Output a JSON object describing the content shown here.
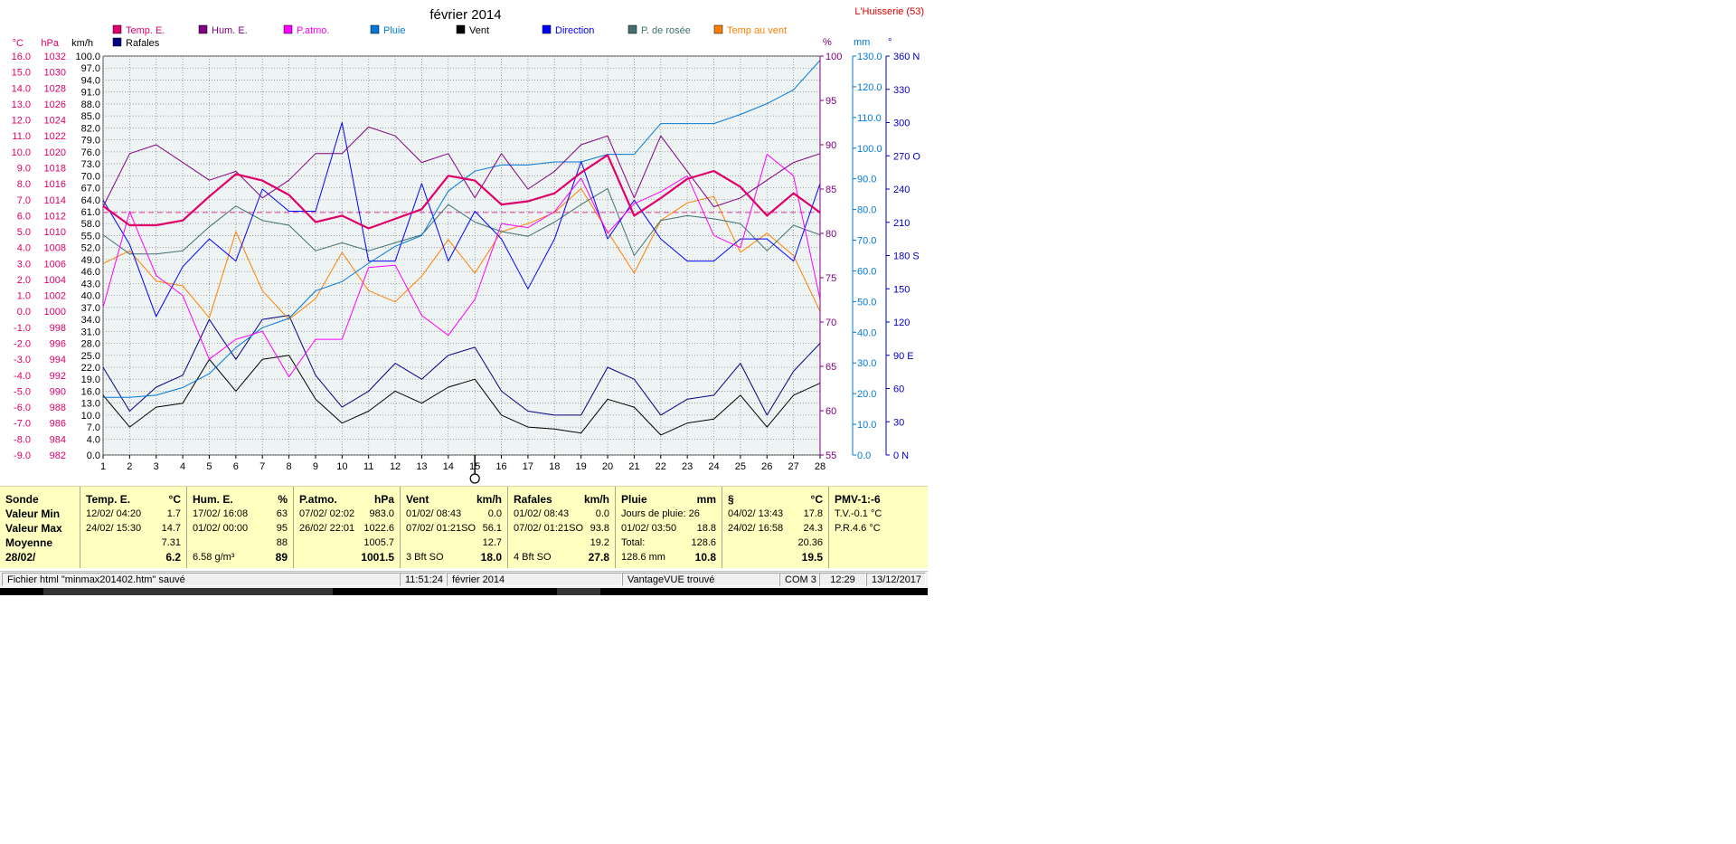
{
  "chart_data": {
    "type": "line",
    "title": "février 2014",
    "location": "L'Huisserie (53)",
    "x": [
      1,
      2,
      3,
      4,
      5,
      6,
      7,
      8,
      9,
      10,
      11,
      12,
      13,
      14,
      15,
      16,
      17,
      18,
      19,
      20,
      21,
      22,
      23,
      24,
      25,
      26,
      27,
      28
    ],
    "xlim": [
      1,
      28
    ],
    "left_axes": [
      {
        "label": "°C",
        "color": "#e0006a",
        "min": -9,
        "max": 16,
        "ticks": [
          "16.0",
          "15.0",
          "14.0",
          "13.0",
          "12.0",
          "11.0",
          "10.0",
          "9.0",
          "8.0",
          "7.0",
          "6.0",
          "5.0",
          "4.0",
          "3.0",
          "2.0",
          "1.0",
          "0.0",
          "-1.0",
          "-2.0",
          "-3.0",
          "-4.0",
          "-5.0",
          "-6.0",
          "-7.0",
          "-8.0",
          "-9.0"
        ]
      },
      {
        "label": "hPa",
        "color": "#e0006a",
        "min": 982,
        "max": 1032,
        "ticks": [
          "1032",
          "1030",
          "1028",
          "1026",
          "1024",
          "1022",
          "1020",
          "1018",
          "1016",
          "1014",
          "1012",
          "1010",
          "1008",
          "1006",
          "1004",
          "1002",
          "1000",
          "998",
          "996",
          "994",
          "992",
          "990",
          "988",
          "986",
          "984",
          "982"
        ]
      },
      {
        "label": "km/h",
        "color": "#000000",
        "min": 0,
        "max": 100,
        "ticks": [
          "100.0",
          "97.0",
          "94.0",
          "91.0",
          "88.0",
          "85.0",
          "82.0",
          "79.0",
          "76.0",
          "73.0",
          "70.0",
          "67.0",
          "64.0",
          "61.0",
          "58.0",
          "55.0",
          "52.0",
          "49.0",
          "46.0",
          "43.0",
          "40.0",
          "37.0",
          "34.0",
          "31.0",
          "28.0",
          "25.0",
          "22.0",
          "19.0",
          "16.0",
          "13.0",
          "10.0",
          "7.0",
          "4.0",
          "0.0"
        ]
      }
    ],
    "right_axes": [
      {
        "label": "%",
        "color": "#800080",
        "min": 55,
        "max": 100,
        "ticks": [
          "100",
          "95",
          "90",
          "85",
          "80",
          "75",
          "70",
          "65",
          "60",
          "55"
        ]
      },
      {
        "label": "mm",
        "color": "#0078d7",
        "min": 0,
        "max": 130,
        "ticks": [
          "130.0",
          "120.0",
          "110.0",
          "100.0",
          "90.0",
          "80.0",
          "70.0",
          "60.0",
          "50.0",
          "40.0",
          "30.0",
          "20.0",
          "10.0",
          "0.0"
        ]
      },
      {
        "label": "°",
        "color": "#0000c0",
        "min": 0,
        "max": 360,
        "ticks": [
          "360 N",
          "330",
          "300",
          "270 O",
          "240",
          "210",
          "180 S",
          "150",
          "120",
          "90 E",
          "60",
          "30",
          "0 N"
        ]
      }
    ],
    "grid": true,
    "legend_position": "top",
    "reference_line": {
      "axis": "°C",
      "value": 6.2,
      "color": "#e040a0",
      "style": "dashed"
    },
    "cursor_day": 15,
    "series": [
      {
        "name": "Temp. E.",
        "color": "#e0006a",
        "axis": "°C",
        "width": 2.2,
        "values": [
          6.6,
          5.4,
          5.4,
          5.7,
          7.2,
          8.6,
          8.2,
          7.3,
          5.6,
          6.0,
          5.2,
          5.8,
          6.4,
          8.5,
          8.2,
          6.7,
          6.9,
          7.4,
          8.7,
          9.8,
          6.0,
          7.1,
          8.3,
          8.8,
          7.8,
          6.0,
          7.4,
          6.2
        ]
      },
      {
        "name": "Hum. E.",
        "color": "#800080",
        "axis": "%",
        "width": 1,
        "values": [
          83,
          89,
          90,
          88,
          86,
          87,
          84,
          86,
          89,
          89,
          92,
          91,
          88,
          89,
          84,
          89,
          85,
          87,
          90,
          91,
          84,
          91,
          87,
          83,
          84,
          86,
          88,
          89
        ]
      },
      {
        "name": "P.atmo.",
        "color": "#ff00ff",
        "axis": "hPa",
        "width": 1,
        "values": [
          1000.5,
          1012.5,
          1004.5,
          1002.0,
          994.0,
          996.5,
          997.5,
          991.8,
          996.5,
          996.5,
          1005.5,
          1005.8,
          999.5,
          997.0,
          1001.5,
          1011.0,
          1010.5,
          1012.5,
          1016.7,
          1009.8,
          1013.5,
          1015.0,
          1017.0,
          1009.5,
          1008.0,
          1019.7,
          1017.0,
          1001.5
        ]
      },
      {
        "name": "Pluie",
        "color": "#0078d7",
        "axis": "mm",
        "width": 1,
        "values": [
          18.8,
          18.8,
          19.5,
          22.0,
          26.5,
          35.0,
          41.5,
          44.5,
          53.5,
          56.5,
          62.5,
          68.0,
          71.5,
          86.0,
          92.5,
          94.5,
          94.5,
          95.5,
          95.5,
          98.0,
          98.0,
          108.0,
          108.0,
          108.0,
          111.0,
          114.5,
          119.0,
          128.6
        ]
      },
      {
        "name": "Vent",
        "color": "#000000",
        "axis": "km/h",
        "width": 1,
        "values": [
          15.0,
          7.0,
          12.0,
          13.0,
          24.0,
          16.0,
          24.0,
          25.0,
          14.0,
          8.0,
          11.0,
          16.0,
          13.0,
          17.0,
          19.0,
          10.0,
          7.0,
          6.5,
          5.5,
          14.0,
          12.0,
          5.0,
          8.0,
          9.0,
          15.0,
          7.0,
          15.0,
          18.0
        ]
      },
      {
        "name": "Direction",
        "color": "#0000ff",
        "axis": "°",
        "width": 1,
        "values": [
          230,
          190,
          125,
          170,
          195,
          175,
          240,
          220,
          220,
          300,
          175,
          175,
          245,
          175,
          220,
          195,
          150,
          195,
          265,
          195,
          230,
          195,
          175,
          175,
          195,
          195,
          175,
          245
        ]
      },
      {
        "name": "P. de rosée",
        "color": "#407070",
        "axis": "°C",
        "width": 1,
        "values": [
          4.8,
          3.6,
          3.6,
          3.8,
          5.3,
          6.6,
          5.7,
          5.4,
          3.8,
          4.3,
          3.8,
          4.3,
          4.8,
          6.7,
          5.6,
          5.0,
          4.7,
          5.6,
          6.7,
          7.7,
          3.5,
          5.7,
          6.0,
          5.8,
          5.5,
          3.8,
          5.4,
          4.8
        ]
      },
      {
        "name": "Temp au vent",
        "color": "#ff8000",
        "axis": "°C",
        "width": 1,
        "values": [
          3.0,
          3.8,
          1.9,
          1.6,
          -0.4,
          5.0,
          1.3,
          -0.5,
          0.8,
          3.7,
          1.3,
          0.6,
          2.2,
          4.5,
          2.4,
          5.0,
          5.5,
          6.2,
          7.7,
          5.0,
          2.4,
          5.7,
          6.8,
          7.2,
          3.7,
          4.9,
          3.5,
          0.0
        ]
      },
      {
        "name": "Rafales",
        "color": "#000080",
        "axis": "km/h",
        "width": 1,
        "values": [
          22.0,
          11.0,
          17.0,
          20.0,
          34.0,
          24.0,
          34.0,
          35.0,
          20.0,
          12.0,
          16.0,
          23.0,
          19.0,
          25.0,
          27.0,
          16.0,
          11.0,
          10.0,
          10.0,
          22.0,
          19.0,
          10.0,
          14.0,
          15.0,
          23.0,
          10.0,
          21.0,
          28.0
        ]
      }
    ]
  },
  "stats": {
    "sonde": {
      "title": "Sonde",
      "rows": [
        "Valeur Min",
        "Valeur Max",
        "Moyenne",
        "28/02/"
      ]
    },
    "temp": {
      "title": "Temp. E.",
      "unit": "°C",
      "min_when": "12/02/  04:20",
      "min": "1.7",
      "max_when": "24/02/  15:30",
      "max": "14.7",
      "avg": "7.31",
      "current": "6.2"
    },
    "hum": {
      "title": "Hum. E.",
      "unit": "%",
      "min_when": "17/02/  16:08",
      "min": "63",
      "max_when": "01/02/  00:00",
      "max": "95",
      "avg": "88",
      "extra": "6.58 g/m³",
      "current": "89"
    },
    "patmo": {
      "title": "P.atmo.",
      "unit": "hPa",
      "min_when": "07/02/  02:02",
      "min": "983.0",
      "max_when": "26/02/  22:01",
      "max": "1022.6",
      "avg": "1005.7",
      "current": "1001.5"
    },
    "vent": {
      "title": "Vent",
      "unit": "km/h",
      "min_when": "01/02/  08:43",
      "min": "0.0",
      "max_when": "07/02/  01:21SO",
      "max": "56.1",
      "avg": "12.7",
      "extra": "3 Bft SO",
      "current": "18.0"
    },
    "rafales": {
      "title": "Rafales",
      "unit": "km/h",
      "min_when": "01/02/  08:43",
      "min": "0.0",
      "max_when": "07/02/  01:21SO",
      "max": "93.8",
      "avg": "19.2",
      "extra": "4 Bft SO",
      "current": "27.8"
    },
    "pluie": {
      "title": "Pluie",
      "unit": "mm",
      "days": "Jours de pluie: 26",
      "max_when": "01/02/  03:50",
      "max": "18.8",
      "total_label": "Total:",
      "total": "128.6",
      "extra": "128.6 mm",
      "current": "10.8"
    },
    "s": {
      "title": "§",
      "unit": "°C",
      "min_when": "04/02/  13:43",
      "min": "17.8",
      "max_when": "24/02/  16:58",
      "max": "24.3",
      "avg": "20.36",
      "current": "19.5"
    },
    "pmv": {
      "title": "PMV-1:-6",
      "tv": "T.V.-0.1 °C",
      "pr": "P.R.4.6 °C"
    }
  },
  "status_bar": {
    "message": "Fichier html  \"minmax201402.htm\"  sauvé",
    "time": "11:51:24",
    "month": "février 2014",
    "station": "VantageVUE trouvé",
    "port": "COM 3",
    "clock": "12:29",
    "date": "13/12/2017"
  }
}
